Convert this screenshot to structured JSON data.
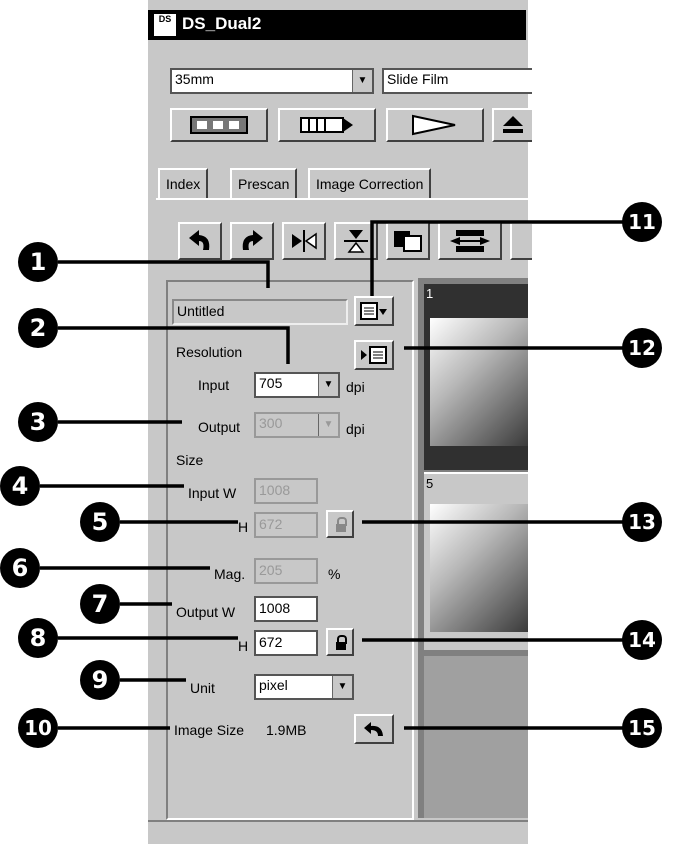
{
  "window": {
    "title": "DS_Dual2",
    "app_icon": "DS"
  },
  "film_format": {
    "value": "35mm"
  },
  "film_type": {
    "value": "Slide Film"
  },
  "tabs": [
    {
      "label": "Index"
    },
    {
      "label": "Prescan"
    },
    {
      "label": "Image Correction"
    }
  ],
  "job": {
    "name": "Untitled"
  },
  "resolution": {
    "heading": "Resolution",
    "input_label": "Input",
    "input_value": "705",
    "input_unit": "dpi",
    "output_label": "Output",
    "output_value": "300",
    "output_unit": "dpi"
  },
  "size": {
    "heading": "Size",
    "input_w_label": "Input W",
    "input_w_value": "1008",
    "input_h_label": "H",
    "input_h_value": "672",
    "mag_label": "Mag.",
    "mag_value": "205",
    "mag_unit": "%",
    "output_w_label": "Output W",
    "output_w_value": "1008",
    "output_h_label": "H",
    "output_h_value": "672"
  },
  "unit": {
    "label": "Unit",
    "value": "pixel"
  },
  "image_size": {
    "label": "Image Size",
    "value": "1.9MB"
  },
  "frames": [
    {
      "number": "1"
    },
    {
      "number": "5"
    }
  ],
  "callouts": [
    "1",
    "2",
    "3",
    "4",
    "5",
    "6",
    "7",
    "8",
    "9",
    "10",
    "11",
    "12",
    "13",
    "14",
    "15"
  ]
}
